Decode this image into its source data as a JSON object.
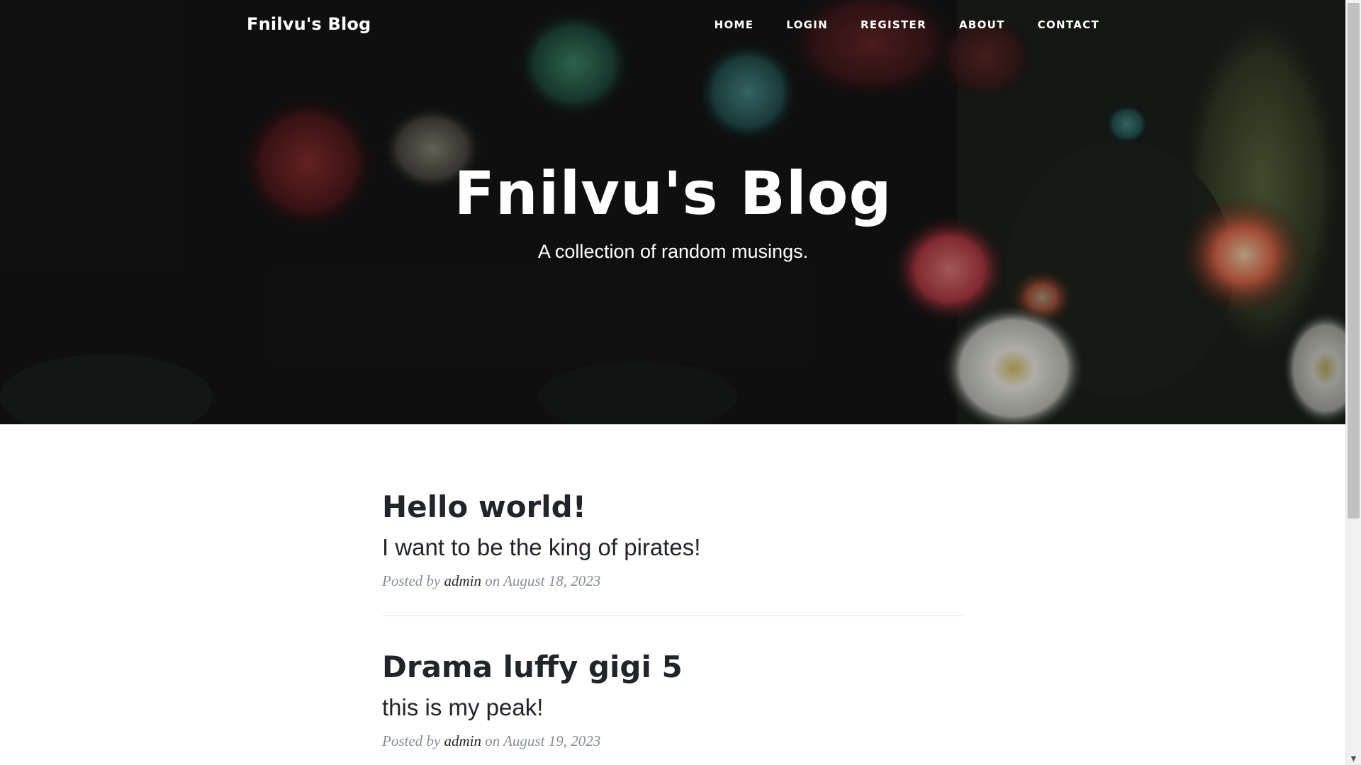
{
  "navbar": {
    "brand": "Fnilvu's Blog",
    "links": [
      {
        "label": "HOME"
      },
      {
        "label": "LOGIN"
      },
      {
        "label": "REGISTER"
      },
      {
        "label": "ABOUT"
      },
      {
        "label": "CONTACT"
      }
    ]
  },
  "hero": {
    "title": "Fnilvu's Blog",
    "subtitle": "A collection of random musings."
  },
  "posts": [
    {
      "title": "Hello world!",
      "subtitle": "I want to be the king of pirates!",
      "posted_by": "Posted by",
      "author": "admin",
      "on": "on",
      "date": "August 18, 2023"
    },
    {
      "title": "Drama luffy gigi 5",
      "subtitle": "this is my peak!",
      "posted_by": "Posted by",
      "author": "admin",
      "on": "on",
      "date": "August 19, 2023"
    }
  ],
  "colors": {
    "heading": "#212529",
    "meta": "#868e96",
    "divider": "#dee2e6",
    "hero_text": "#ffffff"
  },
  "icons": {
    "scroll_up": "triangle-up-icon",
    "scroll_down": "triangle-down-icon"
  }
}
